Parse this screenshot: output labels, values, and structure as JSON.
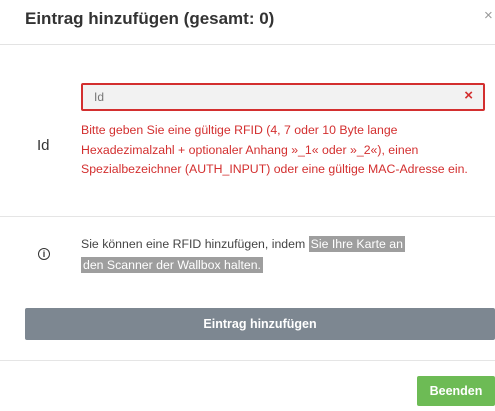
{
  "dialog": {
    "title": "Eintrag hinzufügen (gesamt: 0)",
    "close_symbol": "×"
  },
  "form": {
    "id_label": "Id",
    "id_input": {
      "placeholder": "Id",
      "value": ""
    },
    "clear_symbol": "×",
    "error_message": "Bitte geben Sie eine gültige RFID (4, 7 oder 10 Byte lange Hexadezimalzahl + optionaler Anhang »_1« oder »_2«), einen Spezialbezeichner (AUTH_INPUT) oder eine gültige MAC-Adresse ein."
  },
  "info": {
    "icon": "info-circle-icon",
    "icon_glyph": "i",
    "text_before": "Sie können eine RFID hinzufügen, indem ",
    "highlight_line1": "Sie Ihre Karte an",
    "highlight_line2": "den Scanner der Wallbox halten."
  },
  "buttons": {
    "add_entry": "Eintrag hinzufügen",
    "finish": "Beenden"
  },
  "colors": {
    "error": "#d32f2f",
    "add_button_bg": "#7d8791",
    "finish_button_bg": "#6dbb55",
    "highlight_bg": "#9e9e9e",
    "input_bg": "#f2f2f2"
  }
}
